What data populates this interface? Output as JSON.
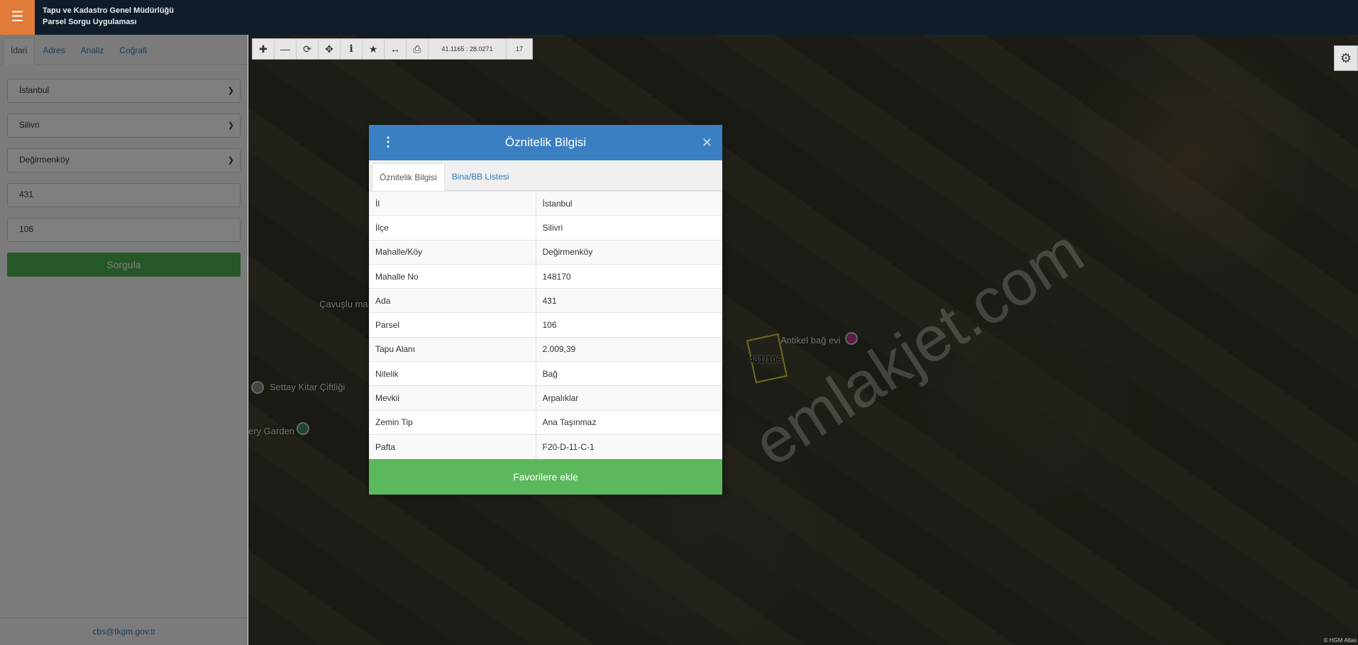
{
  "header": {
    "menu_icon": "hamburger-icon",
    "line1": "Tapu ve Kadastro Genel Müdürlüğü",
    "line2": "Parsel Sorgu Uygulaması"
  },
  "sidebar": {
    "tabs": [
      "İdari",
      "Adres",
      "Analiz",
      "Coğrafi"
    ],
    "active_tab": "İdari",
    "il": "İstanbul",
    "ilce": "Silivri",
    "mahalle": "Değirmenköy",
    "ada": "431",
    "parsel": "106",
    "search_label": "Sorgula",
    "footer_email": "cbs@tkgm.gov.tr"
  },
  "toolbar": {
    "coords": "41.1165 : 28.0271",
    "zoom": "17"
  },
  "map": {
    "place_cavuslu": "Çavuşlu ma",
    "place_settay": "Settay Kitar Çiftliği",
    "place_garden": "ery Garden",
    "place_antikel": "Antikel bağ evi",
    "parcel_label": "431/106",
    "watermark": "emlakjet.com",
    "attribution": "© HGM Atlas"
  },
  "modal": {
    "title": "Öznitelik Bilgisi",
    "tabs": [
      "Öznitelik Bilgisi",
      "Bina/BB Listesi"
    ],
    "rows": [
      {
        "key": "İl",
        "value": "İstanbul"
      },
      {
        "key": "İlçe",
        "value": "Silivri"
      },
      {
        "key": "Mahalle/Köy",
        "value": "Değirmenköy"
      },
      {
        "key": "Mahalle No",
        "value": "148170"
      },
      {
        "key": "Ada",
        "value": "431"
      },
      {
        "key": "Parsel",
        "value": "106"
      },
      {
        "key": "Tapu Alanı",
        "value": "2.009,39"
      },
      {
        "key": "Nitelik",
        "value": "Bağ"
      },
      {
        "key": "Mevkii",
        "value": "Arpalıklar"
      },
      {
        "key": "Zemin Tip",
        "value": "Ana Taşınmaz"
      },
      {
        "key": "Pafta",
        "value": "F20-D-11-C-1"
      }
    ],
    "favorite_label": "Favorilere ekle"
  }
}
